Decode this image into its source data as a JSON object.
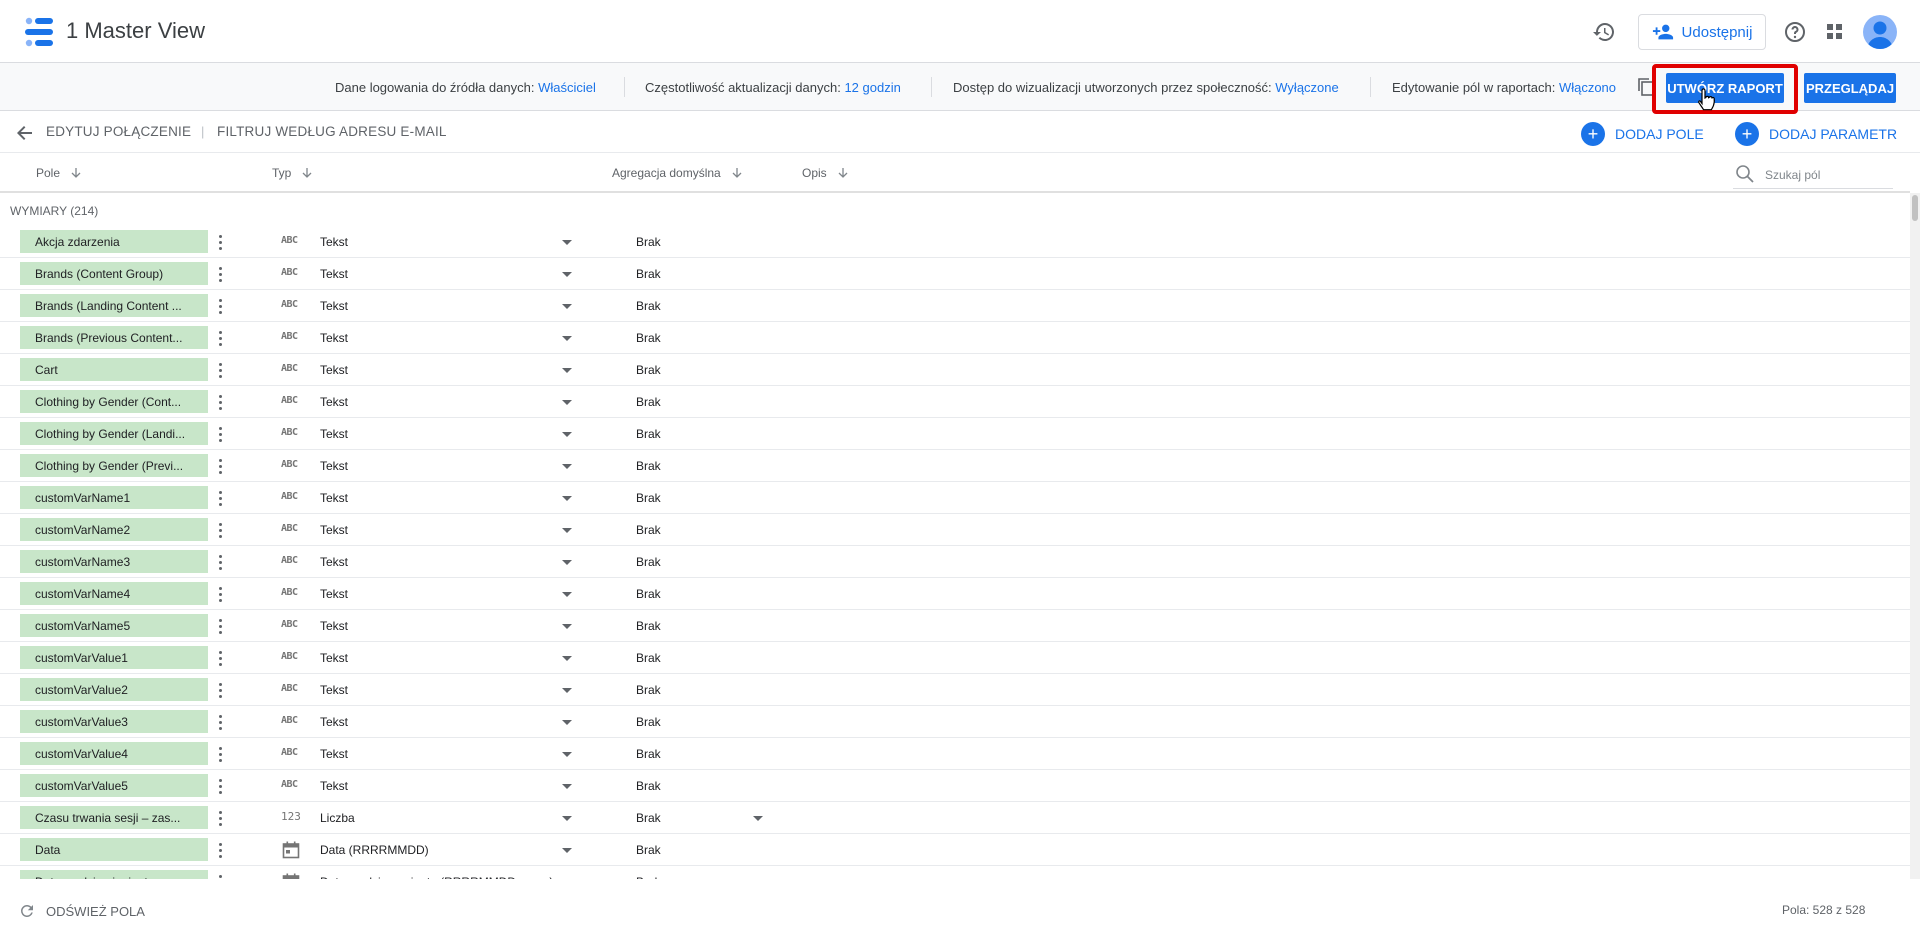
{
  "app": {
    "title": "1 Master View"
  },
  "header": {
    "share_label": "Udostępnij"
  },
  "infobar": {
    "credentials_label": "Dane logowania do źródła danych:",
    "credentials_value": "Właściciel",
    "freshness_label": "Częstotliwość aktualizacji danych:",
    "freshness_value": "12 godzin",
    "community_label": "Dostęp do wizualizacji utworzonych przez społeczność:",
    "community_value": "Wyłączone",
    "edit_fields_label": "Edytowanie pól w raportach:",
    "edit_fields_value": "Włączono",
    "create_report_label": "UTWÓRZ RAPORT",
    "explore_label": "PRZEGLĄDAJ"
  },
  "subnav": {
    "edit_connection": "EDYTUJ POŁĄCZENIE",
    "separator": "|",
    "filter_email": "FILTRUJ WEDŁUG ADRESU E-MAIL",
    "add_field": "DODAJ POLE",
    "add_parameter": "DODAJ PARAMETR"
  },
  "columns": {
    "field": "Pole",
    "type": "Typ",
    "aggregation": "Agregacja domyślna",
    "description": "Opis",
    "search_placeholder": "Szukaj pól"
  },
  "section": {
    "label": "WYMIARY (214)"
  },
  "rows": [
    {
      "name": "Akcja zdarzenia",
      "type_icon": "ABC",
      "type": "Tekst",
      "aggregation": "Brak"
    },
    {
      "name": "Brands (Content Group)",
      "type_icon": "ABC",
      "type": "Tekst",
      "aggregation": "Brak"
    },
    {
      "name": "Brands (Landing Content ...",
      "type_icon": "ABC",
      "type": "Tekst",
      "aggregation": "Brak"
    },
    {
      "name": "Brands (Previous Content...",
      "type_icon": "ABC",
      "type": "Tekst",
      "aggregation": "Brak"
    },
    {
      "name": "Cart",
      "type_icon": "ABC",
      "type": "Tekst",
      "aggregation": "Brak"
    },
    {
      "name": "Clothing by Gender (Cont...",
      "type_icon": "ABC",
      "type": "Tekst",
      "aggregation": "Brak"
    },
    {
      "name": "Clothing by Gender (Landi...",
      "type_icon": "ABC",
      "type": "Tekst",
      "aggregation": "Brak"
    },
    {
      "name": "Clothing by Gender (Previ...",
      "type_icon": "ABC",
      "type": "Tekst",
      "aggregation": "Brak"
    },
    {
      "name": "customVarName1",
      "type_icon": "ABC",
      "type": "Tekst",
      "aggregation": "Brak"
    },
    {
      "name": "customVarName2",
      "type_icon": "ABC",
      "type": "Tekst",
      "aggregation": "Brak"
    },
    {
      "name": "customVarName3",
      "type_icon": "ABC",
      "type": "Tekst",
      "aggregation": "Brak"
    },
    {
      "name": "customVarName4",
      "type_icon": "ABC",
      "type": "Tekst",
      "aggregation": "Brak"
    },
    {
      "name": "customVarName5",
      "type_icon": "ABC",
      "type": "Tekst",
      "aggregation": "Brak"
    },
    {
      "name": "customVarValue1",
      "type_icon": "ABC",
      "type": "Tekst",
      "aggregation": "Brak"
    },
    {
      "name": "customVarValue2",
      "type_icon": "ABC",
      "type": "Tekst",
      "aggregation": "Brak"
    },
    {
      "name": "customVarValue3",
      "type_icon": "ABC",
      "type": "Tekst",
      "aggregation": "Brak"
    },
    {
      "name": "customVarValue4",
      "type_icon": "ABC",
      "type": "Tekst",
      "aggregation": "Brak"
    },
    {
      "name": "customVarValue5",
      "type_icon": "ABC",
      "type": "Tekst",
      "aggregation": "Brak"
    },
    {
      "name": "Czasu trwania sesji – zas...",
      "type_icon": "123",
      "type": "Liczba",
      "aggregation": "Brak",
      "agg_dropdown": true
    },
    {
      "name": "Data",
      "type_icon": "calendar",
      "type": "Data (RRRRMMDD)",
      "aggregation": "Brak"
    },
    {
      "name": "Data, godzina i minuty",
      "type_icon": "calendar",
      "type": "Data, godzina, minuta (RRRRMMDDggmm)",
      "aggregation": "Brak"
    }
  ],
  "footer": {
    "refresh_label": "ODŚWIEŻ POLA",
    "count_label": "Pola: 528 z 528"
  },
  "colors": {
    "accent": "#1a73e8",
    "chip_bg": "#c8e6c9",
    "highlight": "#e00000"
  }
}
